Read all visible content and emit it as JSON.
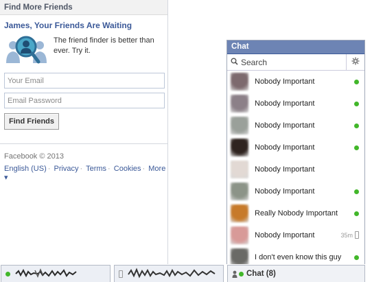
{
  "find_friends": {
    "header": "Find More Friends",
    "heading": "James, Your Friends Are Waiting",
    "description": "The friend finder is better than ever. Try it.",
    "email_placeholder": "Your Email",
    "password_placeholder": "Email Password",
    "button_label": "Find Friends"
  },
  "footer": {
    "copyright": "Facebook © 2013",
    "links": [
      "English (US)",
      "Privacy",
      "Terms",
      "Cookies",
      "More ▾"
    ]
  },
  "chat": {
    "title": "Chat",
    "search_placeholder": "Search",
    "friends": [
      {
        "name": "Nobody Important",
        "status": "online",
        "avatar_color": "#7d6a6e"
      },
      {
        "name": "Nobody Important",
        "status": "online",
        "avatar_color": "#8c8088"
      },
      {
        "name": "Nobody Important",
        "status": "online",
        "avatar_color": "#9aa09a"
      },
      {
        "name": "Nobody Important",
        "status": "online",
        "avatar_color": "#2f2420"
      },
      {
        "name": "Nobody Important",
        "status": "none",
        "avatar_color": "#e2d9d4"
      },
      {
        "name": "Nobody Important",
        "status": "online",
        "avatar_color": "#8c9488"
      },
      {
        "name": "Really Nobody Important",
        "status": "online",
        "avatar_color": "#c77a2a"
      },
      {
        "name": "Nobody Important",
        "status": "idle",
        "idle_time": "35m",
        "avatar_color": "#d89a98"
      },
      {
        "name": "I don't even know this guy",
        "status": "online",
        "avatar_color": "#6a6a66"
      }
    ]
  },
  "bottom_bar": {
    "chat_tab_label": "Chat (8)"
  },
  "colors": {
    "brand_blue": "#3b5998",
    "chat_header": "#6d84b4",
    "online_green": "#42b72a"
  }
}
